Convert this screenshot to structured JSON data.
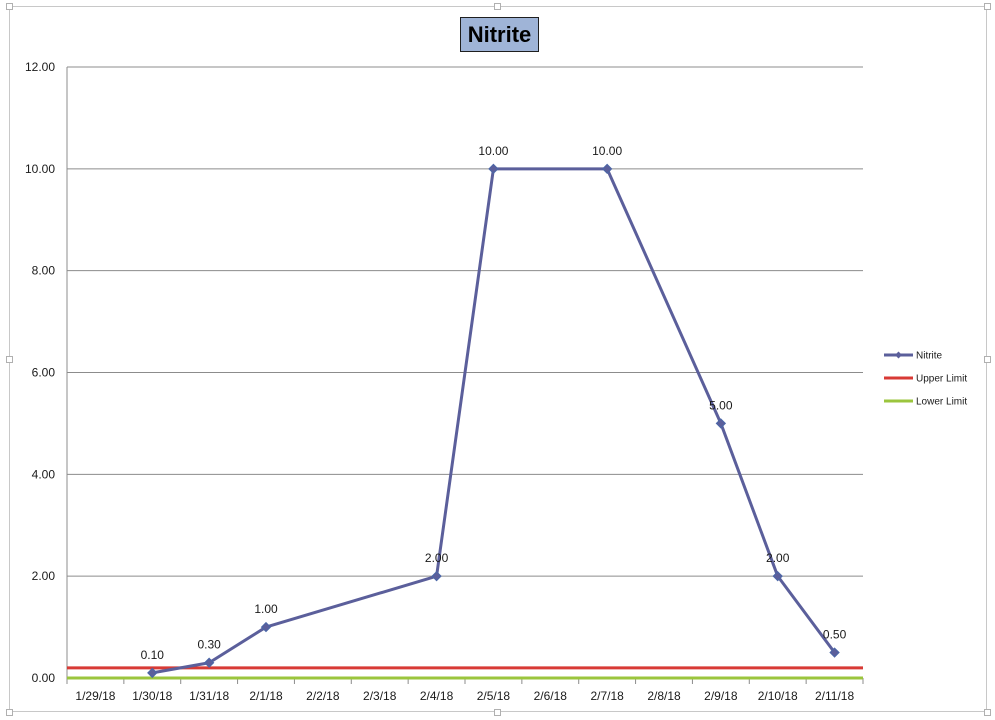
{
  "chart_data": {
    "type": "line",
    "title": "Nitrite",
    "categories": [
      "1/29/18",
      "1/30/18",
      "1/31/18",
      "2/1/18",
      "2/2/18",
      "2/3/18",
      "2/4/18",
      "2/5/18",
      "2/6/18",
      "2/7/18",
      "2/8/18",
      "2/9/18",
      "2/10/18",
      "2/11/18"
    ],
    "ylim": [
      0,
      12
    ],
    "yticks": [
      "0.00",
      "2.00",
      "4.00",
      "6.00",
      "8.00",
      "10.00",
      "12.00"
    ],
    "grid": true,
    "legend": "right",
    "series": [
      {
        "name": "Nitrite",
        "color": "#5b5f9b",
        "marker": "diamond",
        "points": [
          {
            "x": "1/30/18",
            "y": 0.1,
            "label": "0.10"
          },
          {
            "x": "1/31/18",
            "y": 0.3,
            "label": "0.30"
          },
          {
            "x": "2/1/18",
            "y": 1.0,
            "label": "1.00"
          },
          {
            "x": "2/4/18",
            "y": 2.0,
            "label": "2.00"
          },
          {
            "x": "2/5/18",
            "y": 10.0,
            "label": "10.00"
          },
          {
            "x": "2/7/18",
            "y": 10.0,
            "label": "10.00"
          },
          {
            "x": "2/9/18",
            "y": 5.0,
            "label": "5.00"
          },
          {
            "x": "2/10/18",
            "y": 2.0,
            "label": "2.00"
          },
          {
            "x": "2/11/18",
            "y": 0.5,
            "label": "0.50"
          }
        ]
      },
      {
        "name": "Upper Limit",
        "color": "#d83a35",
        "value": 0.2
      },
      {
        "name": "Lower Limit",
        "color": "#9bc53d",
        "value": 0.0
      }
    ]
  }
}
